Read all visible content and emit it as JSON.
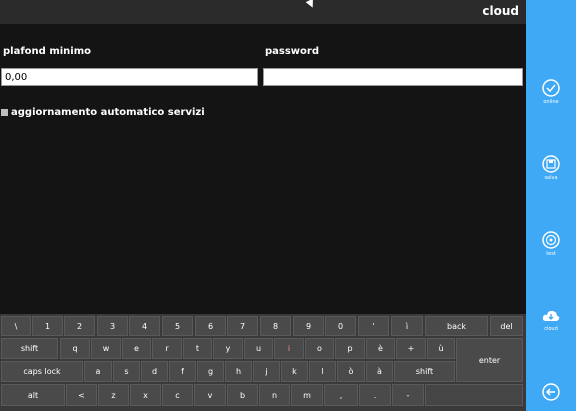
{
  "header": {
    "title": "cloud"
  },
  "form": {
    "min_label": "plafond minimo",
    "min_value": "0,00",
    "password_label": "password",
    "password_value": "",
    "auto_update_label": "aggiornamento automatico servizi"
  },
  "sidebar": {
    "items": [
      {
        "label": "online",
        "icon": "check-circle-icon"
      },
      {
        "label": "salva",
        "icon": "save-icon"
      },
      {
        "label": "test",
        "icon": "broadcast-icon"
      },
      {
        "label": "cloud",
        "icon": "cloud-download-icon"
      },
      {
        "label": "",
        "icon": "back-arrow-icon"
      }
    ]
  },
  "keyboard": {
    "row1": [
      "\\",
      "1",
      "2",
      "3",
      "4",
      "5",
      "6",
      "7",
      "8",
      "9",
      "0",
      "'",
      "ì",
      "back",
      "del"
    ],
    "row2": [
      "shift",
      "q",
      "w",
      "e",
      "r",
      "t",
      "y",
      "u",
      "i",
      "o",
      "p",
      "è",
      "+",
      "ù"
    ],
    "row3": [
      "caps lock",
      "a",
      "s",
      "d",
      "f",
      "g",
      "h",
      "j",
      "k",
      "l",
      "ò",
      "à",
      "shift"
    ],
    "row4": [
      "alt",
      "<",
      "z",
      "x",
      "c",
      "v",
      "b",
      "n",
      "m",
      ",",
      ".",
      "-"
    ],
    "enter": "enter"
  },
  "colors": {
    "accent": "#3fa9f5",
    "background": "#141414",
    "keyboard": "#3a3a3a"
  }
}
